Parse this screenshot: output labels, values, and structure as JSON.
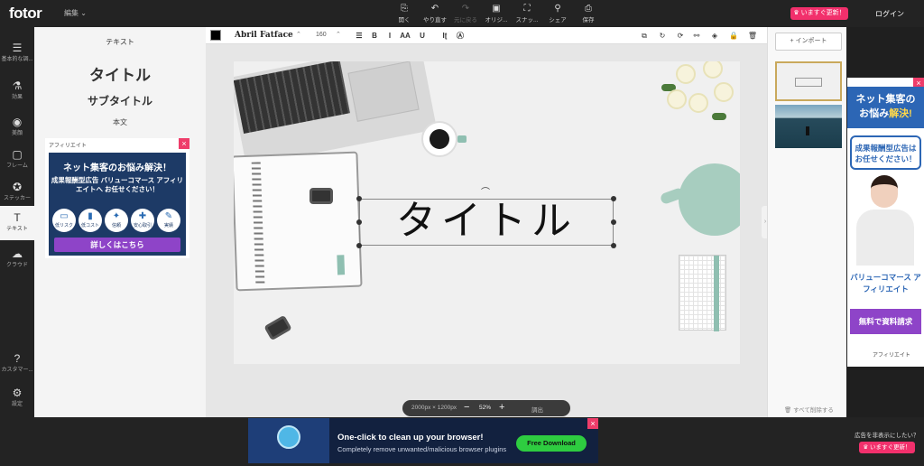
{
  "app": {
    "logo": "fotor",
    "edit_menu": "編集 ⌄"
  },
  "toolbar_top": {
    "tools": [
      {
        "label": "開く",
        "icon": "open-icon",
        "glyph": "⎘"
      },
      {
        "label": "やり直す",
        "icon": "undo-icon",
        "glyph": "↶"
      },
      {
        "label": "元に戻る",
        "icon": "redo-icon",
        "glyph": "↷"
      },
      {
        "label": "オリジ...",
        "icon": "original-icon",
        "glyph": "▣"
      },
      {
        "label": "スナッ...",
        "icon": "snapshot-icon",
        "glyph": "⛶"
      },
      {
        "label": "シェア",
        "icon": "share-icon",
        "glyph": "⚲"
      },
      {
        "label": "保存",
        "icon": "save-icon",
        "glyph": "⎙"
      }
    ],
    "upgrade": "♛ いますぐ更新！",
    "login": "ログイン"
  },
  "left_rail": [
    {
      "label": "基本的な調...",
      "icon": "sliders-icon",
      "glyph": "☰"
    },
    {
      "label": "効果",
      "icon": "flask-icon",
      "glyph": "⚗"
    },
    {
      "label": "美顔",
      "icon": "eye-icon",
      "glyph": "◉"
    },
    {
      "label": "フレーム",
      "icon": "frame-icon",
      "glyph": "▢"
    },
    {
      "label": "ステッカー",
      "icon": "sticker-icon",
      "glyph": "✪"
    },
    {
      "label": "テキスト",
      "icon": "text-icon",
      "glyph": "T"
    },
    {
      "label": "クラウド",
      "icon": "cloud-icon",
      "glyph": "☁"
    },
    {
      "label": "カスタマー...",
      "icon": "help-icon",
      "glyph": "?"
    },
    {
      "label": "設定",
      "icon": "settings-icon",
      "glyph": "⚙"
    }
  ],
  "text_panel": {
    "title": "テキスト",
    "preset_title": "タイトル",
    "preset_subtitle": "サブタイトル",
    "preset_body": "本文"
  },
  "ad_left": {
    "brand": "アフィリエイト",
    "headline": "ネット集客のお悩み解決！",
    "sub": "成果報酬型広告 バリューコマース アフィリエイトへ お任せください！",
    "icons": [
      "低リスク",
      "低コスト",
      "信頼",
      "安心取引",
      "実績"
    ],
    "cta": "詳しくはこちら"
  },
  "text_toolbar": {
    "color": "#000000",
    "font": "Abril Fatface",
    "font_arrow": "⌃",
    "size": "160",
    "size_arrow": "⌃",
    "buttons": [
      "☰",
      "B",
      "I",
      "AA",
      "U",
      "Iʈ",
      "Ⓐ"
    ],
    "actions": [
      "⧉",
      "↻",
      "⟳",
      "⚯",
      "◈",
      "🔒",
      "🗑"
    ]
  },
  "canvas": {
    "title_text": "タイトル",
    "rotate_glyph": "⌒"
  },
  "zoom": {
    "dims": "2000px × 1200px",
    "minus": "−",
    "percent": "52%",
    "plus": "+",
    "fit": "調出"
  },
  "right_panel": {
    "import": "+ インポート",
    "delete_all": "すべて削除する"
  },
  "ad_right": {
    "headline_a": "ネット集客の",
    "headline_b": "お悩み",
    "headline_c": "解決!",
    "bubble": "成果報酬型広告は お任せください！",
    "caption": "バリューコマース アフィリエイト",
    "cta": "無料で資料請求",
    "brand": "アフィリエイト"
  },
  "ad_bottom": {
    "headline": "One-click to clean up your browser!",
    "sub": "Completely remove unwanted/malicious browser plugins",
    "cta": "Free Download"
  },
  "footer": {
    "hide_ads": "広告を非表示にしたい？",
    "upgrade": "♛ いますぐ更新！"
  }
}
